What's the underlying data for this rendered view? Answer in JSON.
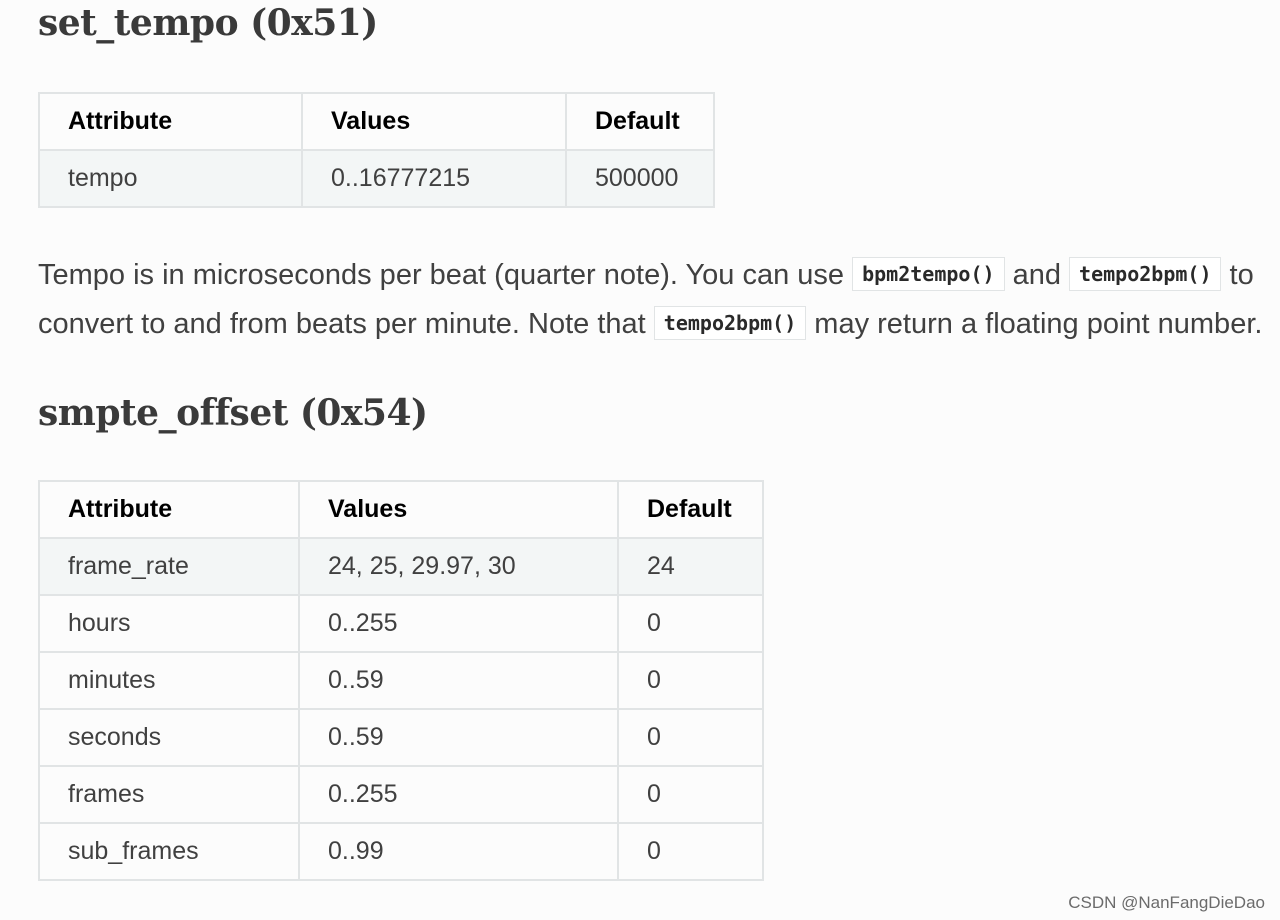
{
  "sections": [
    {
      "heading": "set_tempo (0x51)",
      "table": {
        "headers": [
          "Attribute",
          "Values",
          "Default"
        ],
        "rows": [
          [
            "tempo",
            "0..16777215",
            "500000"
          ]
        ]
      }
    },
    {
      "heading": "smpte_offset (0x54)",
      "table": {
        "headers": [
          "Attribute",
          "Values",
          "Default"
        ],
        "rows": [
          [
            "frame_rate",
            "24, 25, 29.97, 30",
            "24"
          ],
          [
            "hours",
            "0..255",
            "0"
          ],
          [
            "minutes",
            "0..59",
            "0"
          ],
          [
            "seconds",
            "0..59",
            "0"
          ],
          [
            "frames",
            "0..255",
            "0"
          ],
          [
            "sub_frames",
            "0..99",
            "0"
          ]
        ]
      }
    }
  ],
  "paragraph": {
    "part1": "Tempo is in microseconds per beat (quarter note). You can use ",
    "code1": "bpm2tempo()",
    "part2": " and ",
    "code2": "tempo2bpm()",
    "part3": " to convert to and from beats per minute. Note that ",
    "code3": "tempo2bpm()",
    "part4": " may return a floating point number."
  },
  "watermark": "CSDN @NanFangDieDao"
}
